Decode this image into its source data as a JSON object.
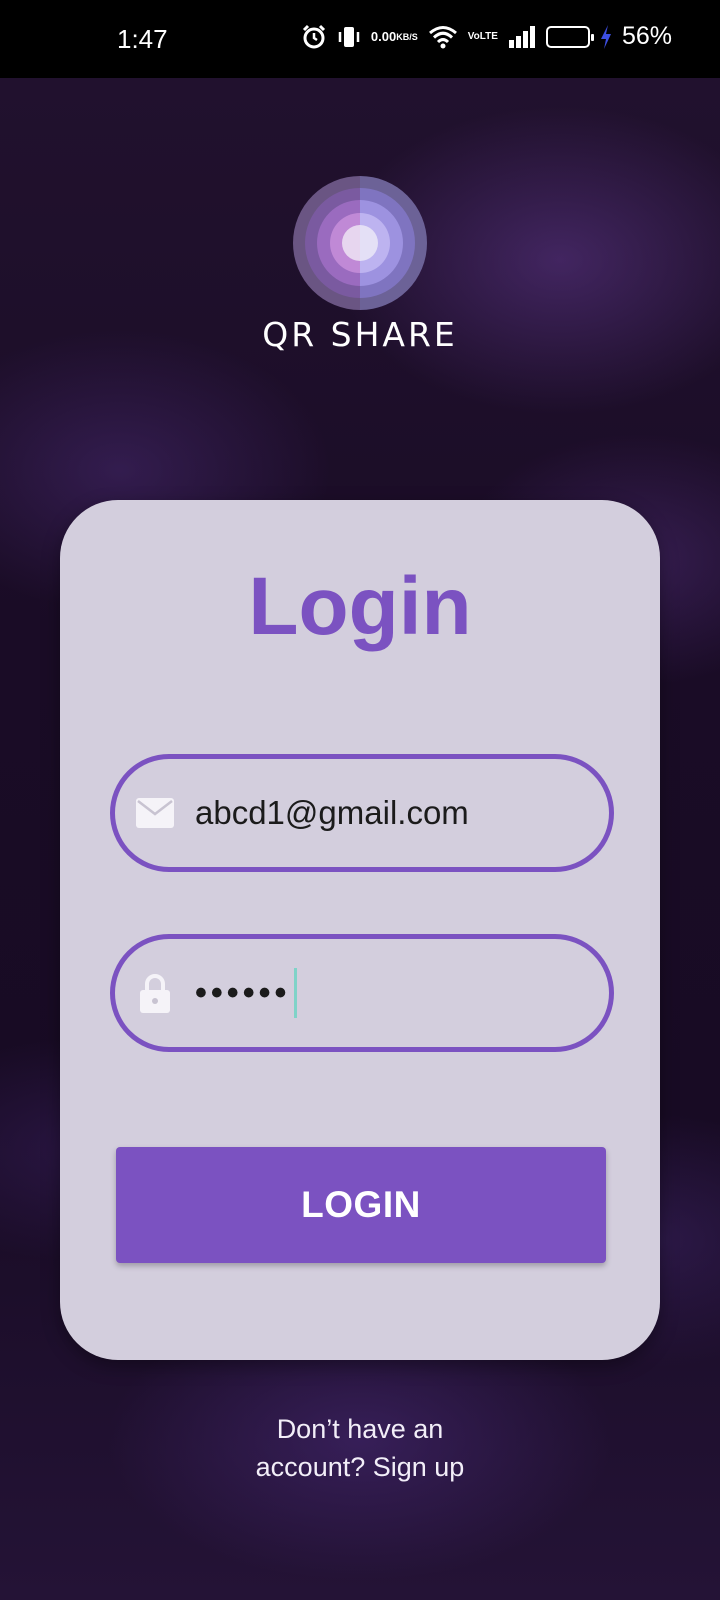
{
  "status_bar": {
    "time": "1:47",
    "net_speed_value": "0.00",
    "net_speed_unit": "KB/S",
    "volte_line1": "Vo",
    "volte_line2": "LTE",
    "battery_percent_text": "56%",
    "battery_level": 0.56,
    "icons": [
      "alarm-icon",
      "vibrate-icon",
      "wifi-icon",
      "signal-icon",
      "battery-icon",
      "charging-icon"
    ]
  },
  "app": {
    "brand_name": "QR SHARE"
  },
  "login_card": {
    "title": "Login",
    "email": {
      "icon": "mail-icon",
      "value": "abcd1@gmail.com"
    },
    "password": {
      "icon": "lock-icon",
      "value": "••••••"
    },
    "login_button_label": "LOGIN"
  },
  "footer": {
    "signup_line1": "Don’t have an",
    "signup_line2": "account? Sign up"
  },
  "colors": {
    "accent": "#7b52c1",
    "card_bg": "#d3cedd",
    "caret": "#7fd3c8",
    "battery_fill": "#3d4ee0"
  }
}
